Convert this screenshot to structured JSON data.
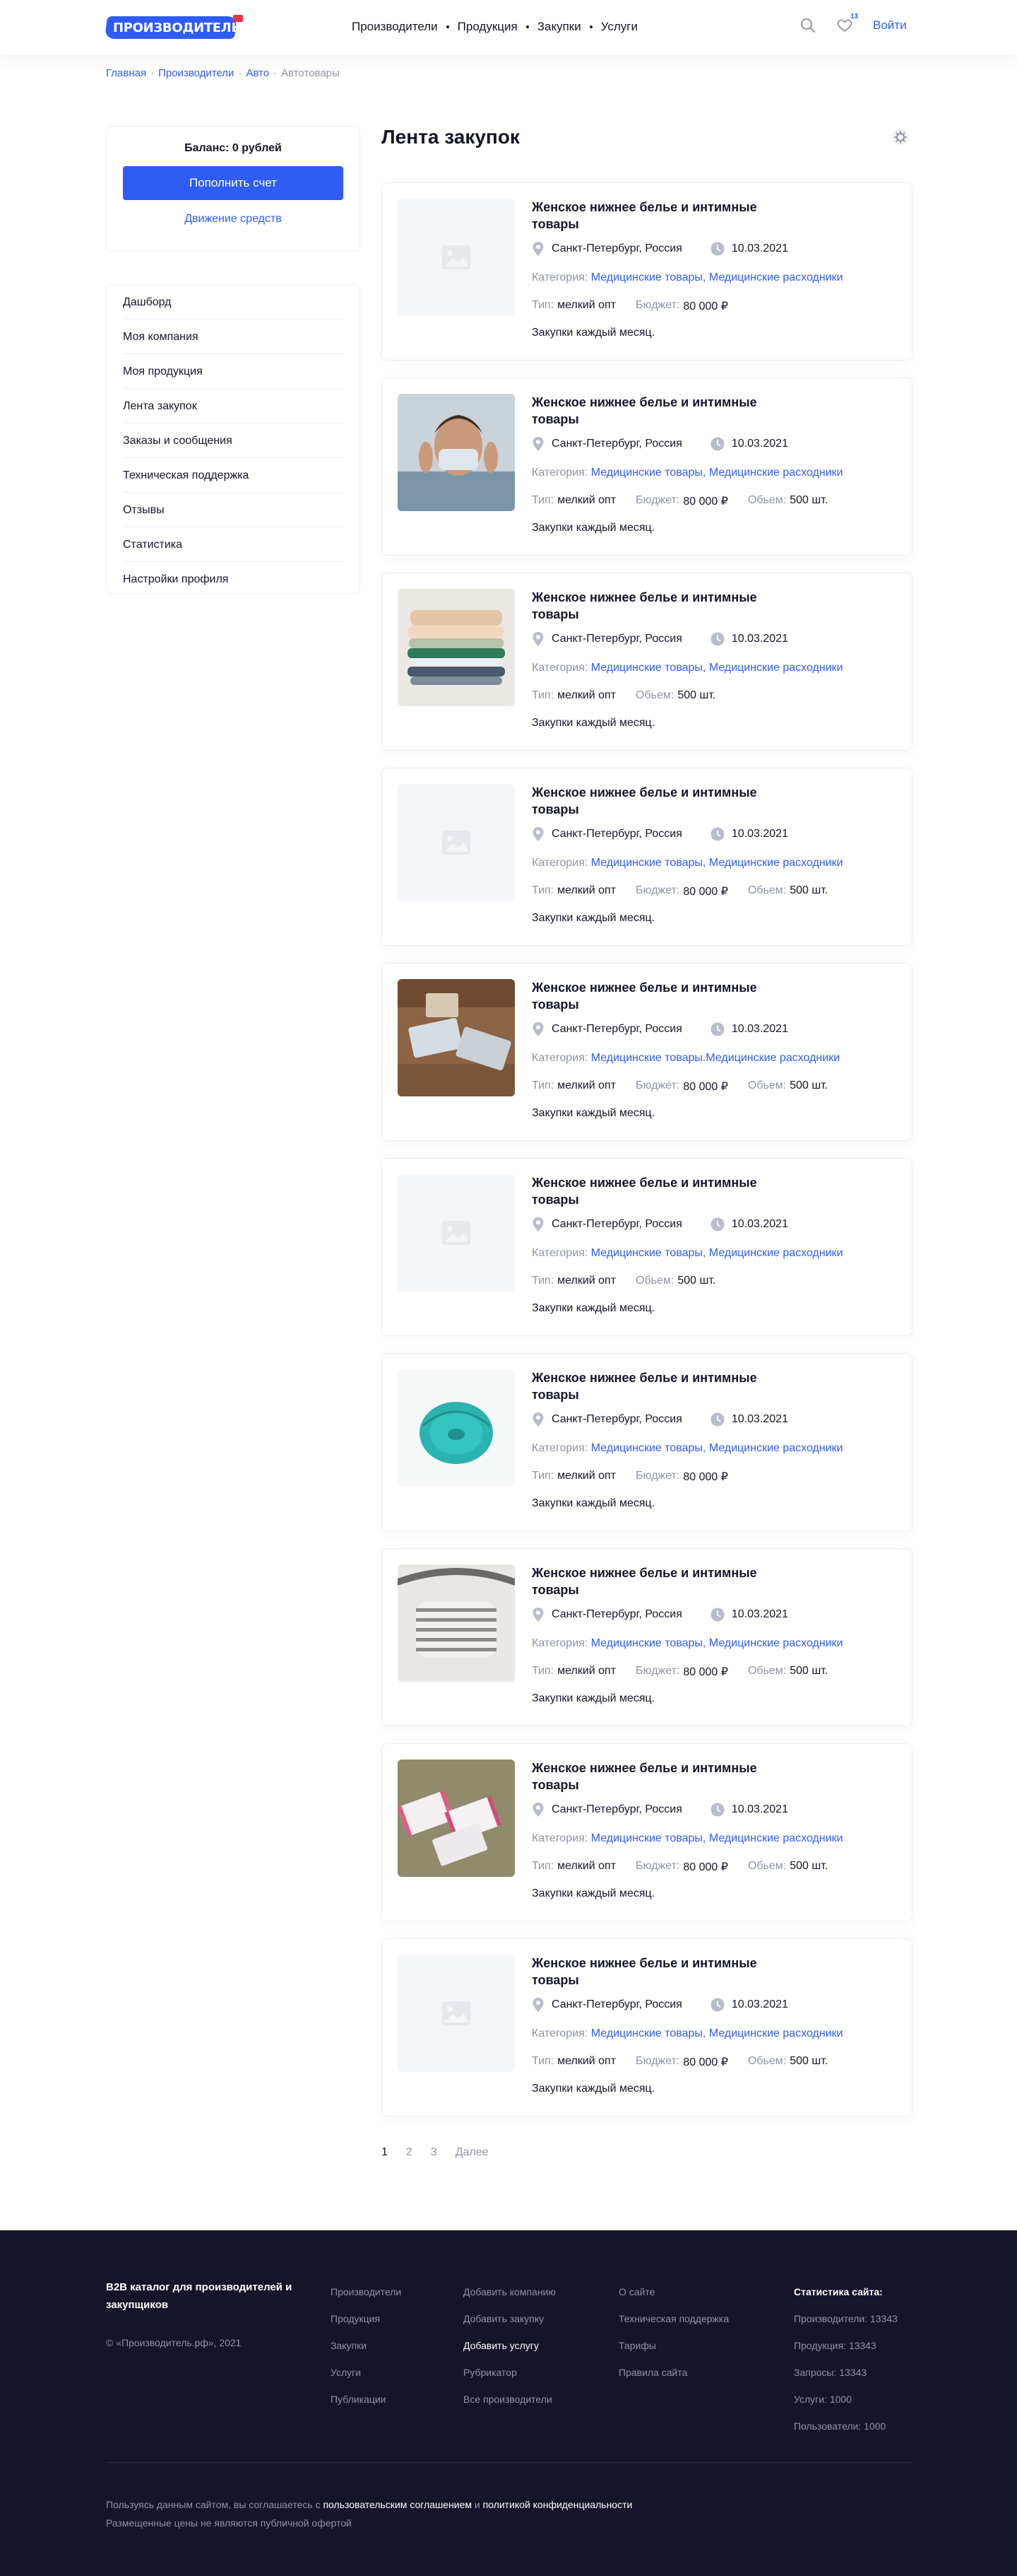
{
  "header": {
    "logo_text": "ПРОИЗВОДИТЕЛЬ.РФ",
    "nav": [
      "Производители",
      "Продукция",
      "Закупки",
      "Услуги"
    ],
    "favorites_count": "13",
    "login": "Войти"
  },
  "breadcrumb": [
    "Главная",
    "Производители",
    "Авто",
    "Автотовары"
  ],
  "sidebar": {
    "balance": "Баланс: 0 рублей",
    "topup_button": "Пополнить счет",
    "movement_link": "Движение средств",
    "menu": [
      "Дашборд",
      "Моя компания",
      "Моя продукция",
      "Лента закупок",
      "Заказы и сообщения",
      "Техническая поддержка",
      "Отзывы",
      "Статистика",
      "Настройки профиля"
    ]
  },
  "feed": {
    "title": "Лента закупок",
    "labels": {
      "category": "Категория:",
      "type": "Тип:",
      "budget": "Бюджет:",
      "volume": "Обьем:"
    },
    "cards": [
      {
        "image": "placeholder",
        "title": "Женское нижнее белье и интимные товары",
        "location": "Санкт-Петербург, Россия",
        "date": "10.03.2021",
        "category_1": "Медицинские товары",
        "sep": ", ",
        "category_2": "Медицинские расходники",
        "type": "мелкий опт",
        "budget": "80 000 ₽",
        "volume": "",
        "description": "Закупки каждый месяц."
      },
      {
        "image": "man-mask",
        "title": "Женское нижнее белье и интимные товары",
        "location": "Санкт-Петербург, Россия",
        "date": "10.03.2021",
        "category_1": "Медицинские товары",
        "sep": ", ",
        "category_2": "Медицинские расходники",
        "type": "мелкий опт",
        "budget": "80 000 ₽",
        "volume": "500 шт.",
        "description": "Закупки каждый месяц."
      },
      {
        "image": "masks-stack",
        "title": "Женское нижнее белье и интимные товары",
        "location": "Санкт-Петербург, Россия",
        "date": "10.03.2021",
        "category_1": "Медицинские товары",
        "sep": ", ",
        "category_2": "Медицинские расходники",
        "type": "мелкий опт",
        "budget": "",
        "volume": "500 шт.",
        "description": "Закупки каждый месяц."
      },
      {
        "image": "placeholder",
        "title": "Женское нижнее белье и интимные товары",
        "location": "Санкт-Петербург, Россия",
        "date": "10.03.2021",
        "category_1": "Медицинские товары",
        "sep": ", ",
        "category_2": "Медицинские расходники",
        "type": "мелкий опт",
        "budget": "80 000 ₽",
        "volume": "500 шт.",
        "description": "Закупки каждый месяц."
      },
      {
        "image": "masks-wood",
        "title": "Женское нижнее белье и интимные товары",
        "location": "Санкт-Петербург, Россия",
        "date": "10.03.2021",
        "category_1": "Медицинские товары",
        "sep": ".",
        "category_2": "Медицинские расходники",
        "type": "мелкий опт",
        "budget": "80 000 ₽",
        "volume": "500 шт.",
        "description": "Закупки каждый месяц."
      },
      {
        "image": "placeholder",
        "title": "Женское нижнее белье и интимные товары",
        "location": "Санкт-Петербург, Россия",
        "date": "10.03.2021",
        "category_1": "Медицинские товары",
        "sep": ", ",
        "category_2": "Медицинские расходники",
        "type": "мелкий опт",
        "budget": "",
        "volume": "500 шт.",
        "description": "Закупки каждый месяц."
      },
      {
        "image": "respirator",
        "title": "Женское нижнее белье и интимные товары",
        "location": "Санкт-Петербург, Россия",
        "date": "10.03.2021",
        "category_1": "Медицинские товары",
        "sep": ", ",
        "category_2": "Медицинские расходники",
        "type": "мелкий опт",
        "budget": "80 000 ₽",
        "volume": "",
        "description": "Закупки каждый месяц."
      },
      {
        "image": "striped-mask",
        "title": "Женское нижнее белье и интимные товары",
        "location": "Санкт-Петербург, Россия",
        "date": "10.03.2021",
        "category_1": "Медицинские товары",
        "sep": ", ",
        "category_2": "Медицинские расходники",
        "type": "мелкий опт",
        "budget": "80 000 ₽",
        "volume": "500 шт.",
        "description": "Закупки каждый месяц."
      },
      {
        "image": "masks-pink",
        "title": "Женское нижнее белье и интимные товары",
        "location": "Санкт-Петербург, Россия",
        "date": "10.03.2021",
        "category_1": "Медицинские товары",
        "sep": ", ",
        "category_2": "Медицинские расходники",
        "type": "мелкий опт",
        "budget": "80 000 ₽",
        "volume": "500 шт.",
        "description": "Закупки каждый месяц."
      },
      {
        "image": "placeholder",
        "title": "Женское нижнее белье и интимные товары",
        "location": "Санкт-Петербург, Россия",
        "date": "10.03.2021",
        "category_1": "Медицинские товары",
        "sep": ", ",
        "category_2": "Медицинские расходники",
        "type": "мелкий опт",
        "budget": "80 000 ₽",
        "volume": "500 шт.",
        "description": "Закупки каждый месяц."
      }
    ]
  },
  "pagination": {
    "pages": [
      "1",
      "2",
      "3"
    ],
    "next": "Далее",
    "current": "1"
  },
  "footer": {
    "brand": "B2B каталог для производителей и закупщиков",
    "copyright": "© «Производитель.рф», 2021",
    "col1": [
      "Производители",
      "Продукция",
      "Закупки",
      "Услуги",
      "Публикации"
    ],
    "col2": [
      "Добавить компанию",
      "Добавить закупку",
      "Добавить услугу",
      "Рубрикатор",
      "Все производители"
    ],
    "col2_highlight": "Добавить услугу",
    "col3": [
      "О сайте",
      "Техническая поддержка",
      "Тарифы",
      "Правила сайта"
    ],
    "stats_title": "Статистика сайта:",
    "stats": [
      "Производители: 13343",
      "Продукция: 13343",
      "Запросы: 13343",
      "Услуги: 1000",
      "Пользователи: 1000"
    ],
    "legal_prefix": "Пользуясь данным сайтом, вы соглашаетесь с ",
    "legal_link1": "пользовательским соглашением",
    "legal_and": " и ",
    "legal_link2": "политикой конфиденциальности",
    "legal_note": "Размещенные цены не являются публичной офертой"
  },
  "colors": {
    "accent": "#2f5cf5",
    "text": "#15162a",
    "muted": "#8e93a6",
    "footer_bg": "#15142a",
    "logo_flag": "#e8334a"
  }
}
